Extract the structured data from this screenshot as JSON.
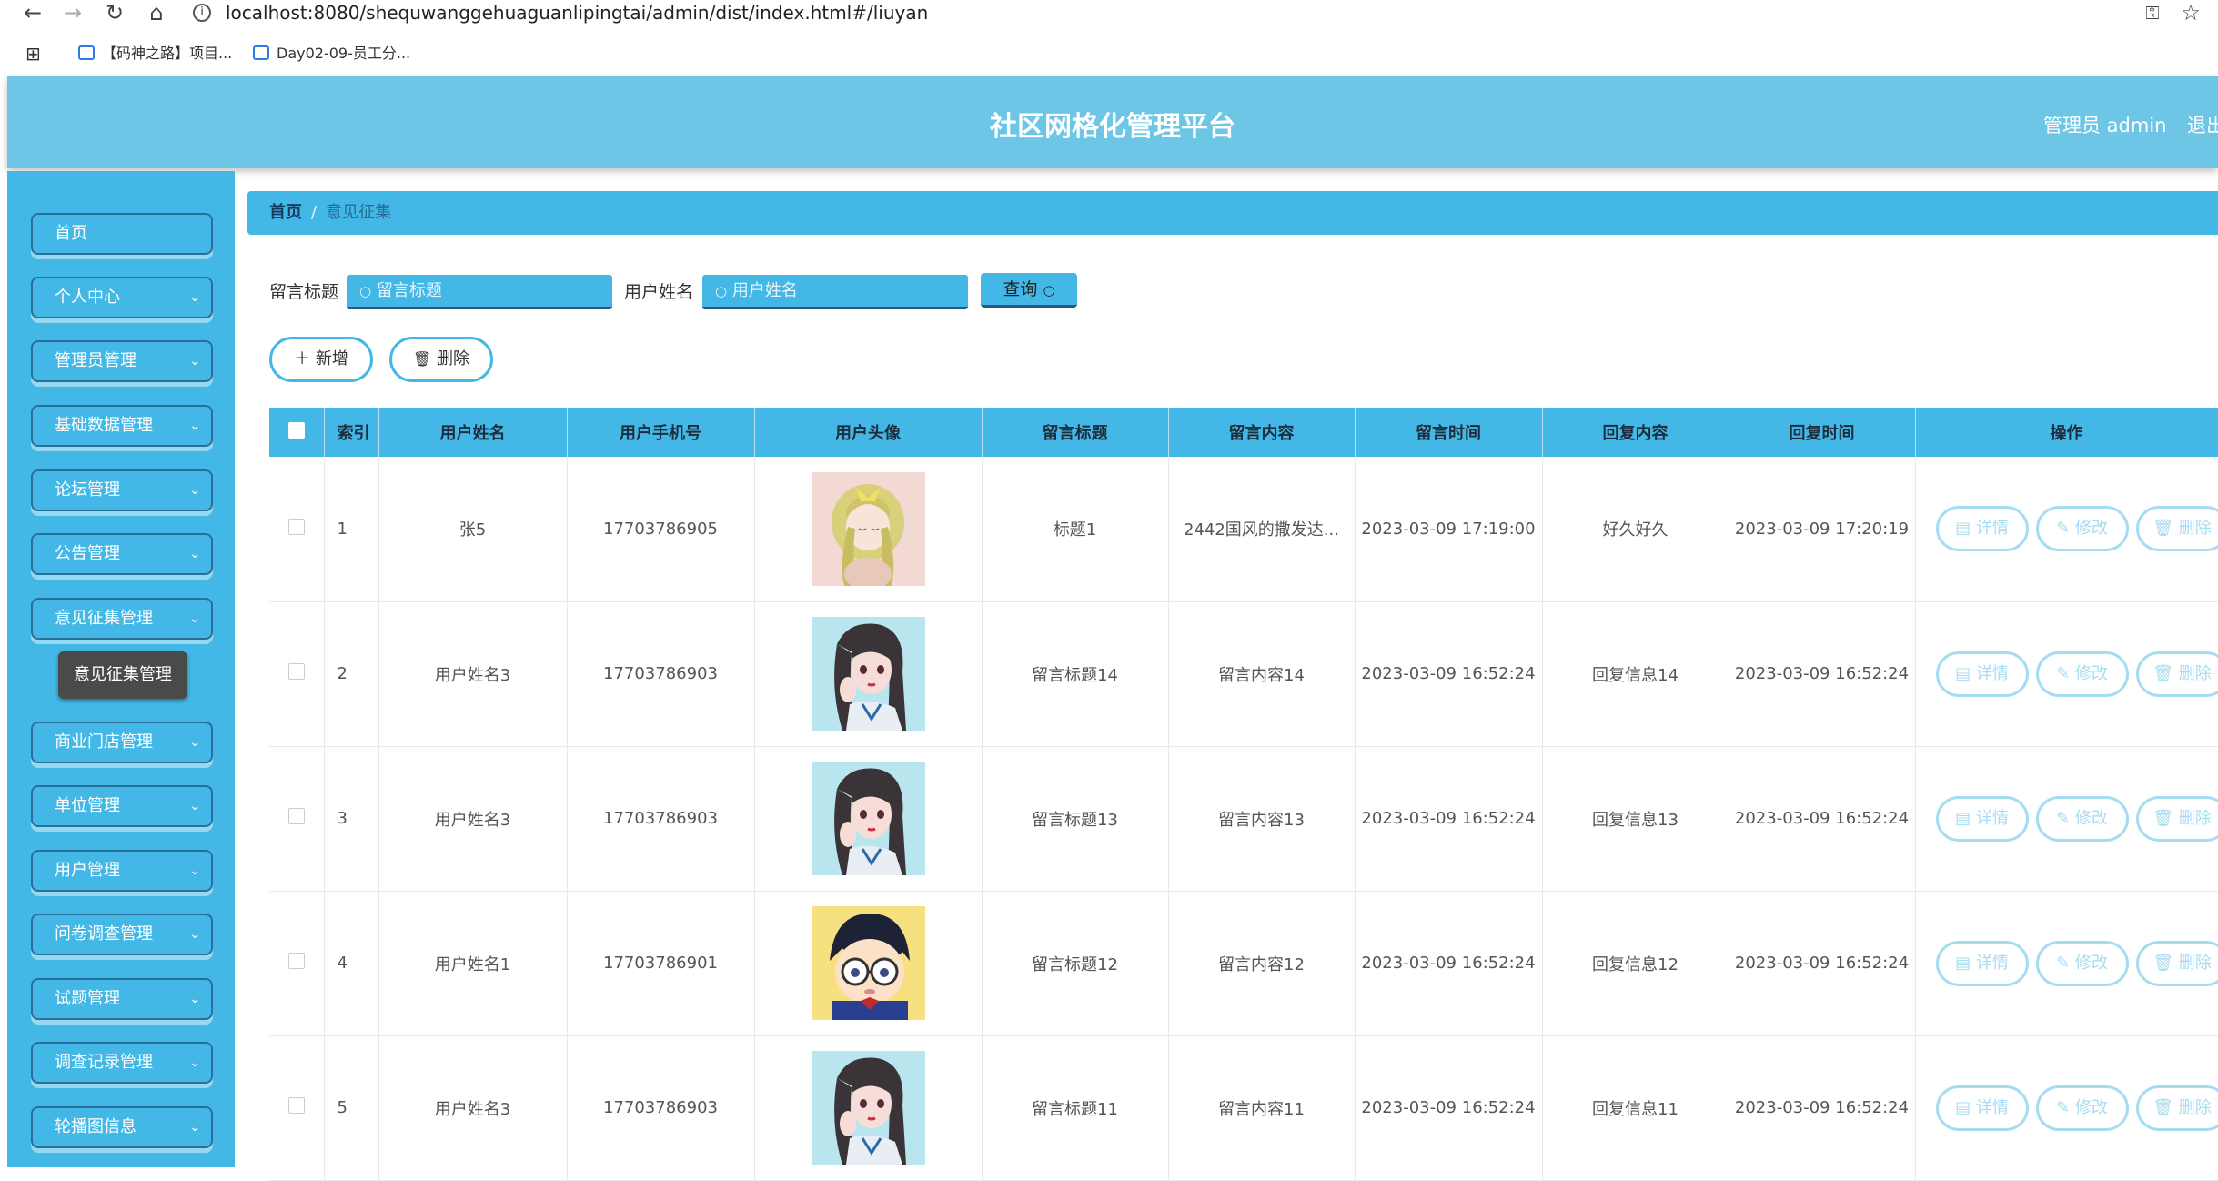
{
  "browser": {
    "url": "localhost:8080/shequwanggehuaguanlipingtai/admin/dist/index.html#/liuyan",
    "bookmarks": [
      "【码神之路】项目...",
      "Day02-09-员工分..."
    ]
  },
  "header": {
    "title": "社区网格化管理平台",
    "admin_label": "管理员 admin",
    "logout_label": "退出"
  },
  "sidebar": {
    "items": [
      {
        "label": "首页",
        "has_chevron": false
      },
      {
        "label": "个人中心",
        "has_chevron": true
      },
      {
        "label": "管理员管理",
        "has_chevron": true
      },
      {
        "label": "基础数据管理",
        "has_chevron": true
      },
      {
        "label": "论坛管理",
        "has_chevron": true
      },
      {
        "label": "公告管理",
        "has_chevron": true
      },
      {
        "label": "意见征集管理",
        "has_chevron": true
      },
      {
        "label": "商业门店管理",
        "has_chevron": true
      },
      {
        "label": "单位管理",
        "has_chevron": true
      },
      {
        "label": "用户管理",
        "has_chevron": true
      },
      {
        "label": "问卷调查管理",
        "has_chevron": true
      },
      {
        "label": "试题管理",
        "has_chevron": true
      },
      {
        "label": "调查记录管理",
        "has_chevron": true
      },
      {
        "label": "轮播图信息",
        "has_chevron": true
      }
    ],
    "active_sub": "意见征集管理"
  },
  "breadcrumb": {
    "home": "首页",
    "separator": "/",
    "current": "意见征集"
  },
  "filters": {
    "title_label": "留言标题",
    "title_placeholder": "留言标题",
    "name_label": "用户姓名",
    "name_placeholder": "用户姓名",
    "query_label": "查询"
  },
  "actions": {
    "add_label": "新增",
    "delete_label": "删除"
  },
  "table": {
    "headers": [
      "索引",
      "用户姓名",
      "用户手机号",
      "用户头像",
      "留言标题",
      "留言内容",
      "留言时间",
      "回复内容",
      "回复时间",
      "操作"
    ],
    "op_labels": {
      "detail": "详情",
      "edit": "修改",
      "delete": "删除"
    },
    "rows": [
      {
        "index": "1",
        "name": "张5",
        "phone": "17703786905",
        "avatar": "anime-girl-blonde",
        "title": "标题1",
        "content": "2442国风的撒发达...",
        "time": "2023-03-09 17:19:00",
        "reply": "好久好久",
        "reply_time": "2023-03-09 17:20:19"
      },
      {
        "index": "2",
        "name": "用户姓名3",
        "phone": "17703786903",
        "avatar": "anime-girl-dark",
        "title": "留言标题14",
        "content": "留言内容14",
        "time": "2023-03-09 16:52:24",
        "reply": "回复信息14",
        "reply_time": "2023-03-09 16:52:24"
      },
      {
        "index": "3",
        "name": "用户姓名3",
        "phone": "17703786903",
        "avatar": "anime-girl-dark",
        "title": "留言标题13",
        "content": "留言内容13",
        "time": "2023-03-09 16:52:24",
        "reply": "回复信息13",
        "reply_time": "2023-03-09 16:52:24"
      },
      {
        "index": "4",
        "name": "用户姓名1",
        "phone": "17703786901",
        "avatar": "conan-glasses",
        "title": "留言标题12",
        "content": "留言内容12",
        "time": "2023-03-09 16:52:24",
        "reply": "回复信息12",
        "reply_time": "2023-03-09 16:52:24"
      },
      {
        "index": "5",
        "name": "用户姓名3",
        "phone": "17703786903",
        "avatar": "anime-girl-dark",
        "title": "留言标题11",
        "content": "留言内容11",
        "time": "2023-03-09 16:52:24",
        "reply": "回复信息11",
        "reply_time": "2023-03-09 16:52:24"
      }
    ]
  },
  "colors": {
    "primary": "#43b8e6",
    "header": "#6ec6e6",
    "button_outline": "#a6dcf2"
  }
}
